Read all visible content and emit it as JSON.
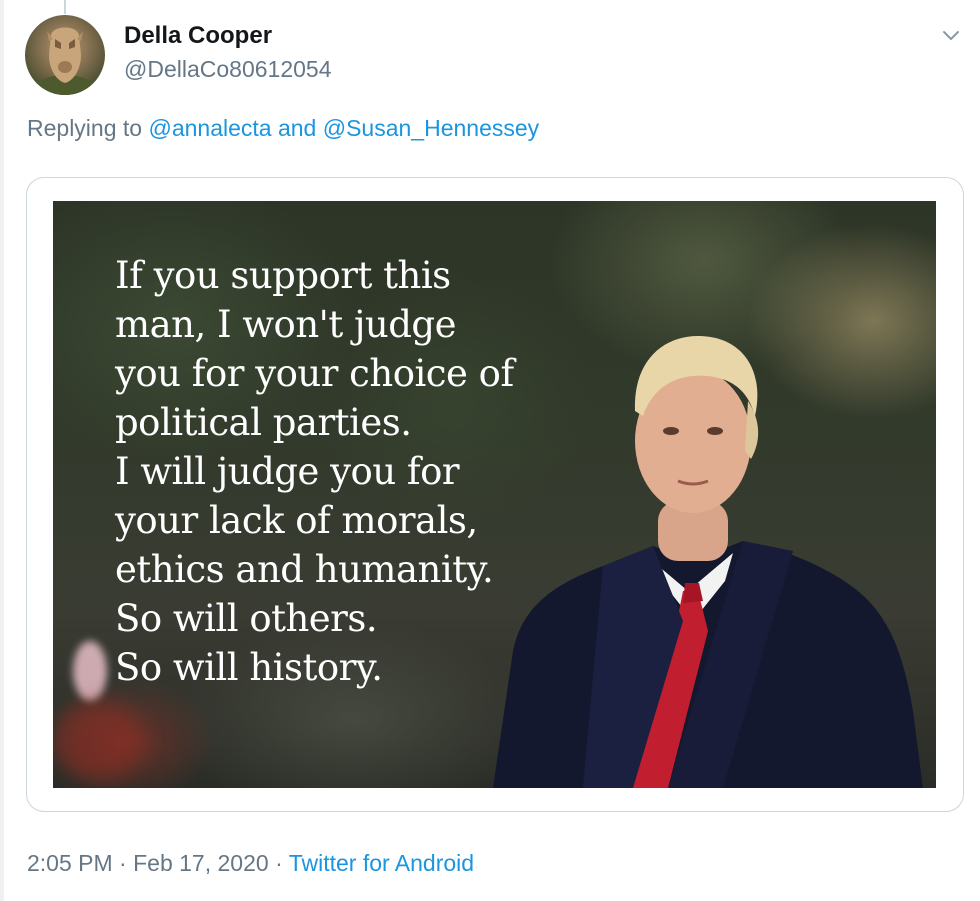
{
  "tweet": {
    "display_name": "Della Cooper",
    "handle": "@DellaCo80612054",
    "replying_prefix": "Replying to",
    "mentions": [
      "@annalecta",
      "@Susan_Hennessey"
    ],
    "mention_joiner": "and",
    "image_text": "If you support this\nman, I won't judge\nyou for your choice of\npolitical parties.\nI will judge you for\nyour lack of morals,\nethics and humanity.\nSo will others.\nSo will history.",
    "time": "2:05 PM",
    "separator": "·",
    "date": "Feb 17, 2020",
    "source": "Twitter for Android"
  },
  "icons": {
    "menu": "chevron-down-icon",
    "avatar": "lioness-photo"
  },
  "colors": {
    "link": "#1b95e0",
    "secondary_text": "#657786",
    "primary_text": "#14171a",
    "card_border": "#ccd6dd"
  }
}
